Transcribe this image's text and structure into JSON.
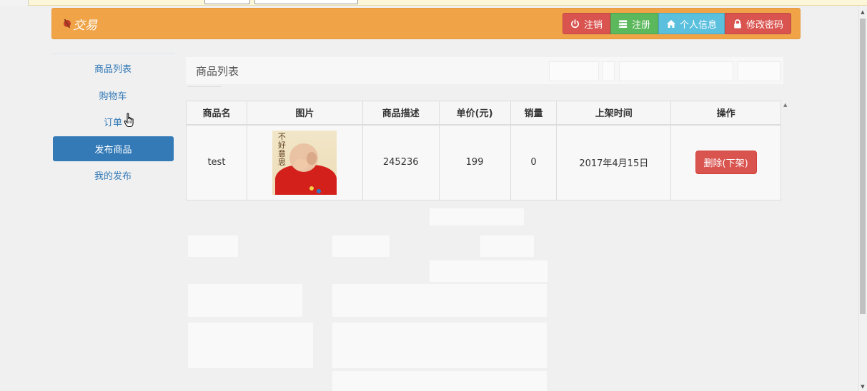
{
  "header": {
    "brand": "交易",
    "buttons": {
      "logout": "注销",
      "register": "注册",
      "profile": "个人信息",
      "change_password": "修改密码"
    },
    "colors": {
      "bar": "#f0a447",
      "logout": "#d9534f",
      "register": "#5cb85c",
      "profile": "#5bc0de",
      "password": "#d9534f"
    }
  },
  "sidebar": {
    "items": [
      {
        "label": "商品列表",
        "active": false
      },
      {
        "label": "购物车",
        "active": false
      },
      {
        "label": "订单",
        "active": false
      },
      {
        "label": "发布商品",
        "active": true
      },
      {
        "label": "我的发布",
        "active": false
      }
    ],
    "active_color": "#337ab7"
  },
  "content": {
    "title": "商品列表"
  },
  "table": {
    "headers": [
      "商品名",
      "图片",
      "商品描述",
      "单价(元)",
      "销量",
      "上架时间",
      "操作"
    ],
    "rows": [
      {
        "name": "test",
        "image_text": "不好意思",
        "description": "245236",
        "price": "199",
        "sales": "0",
        "listed_time": "2017年4月15日",
        "action": "删除(下架)"
      }
    ]
  }
}
